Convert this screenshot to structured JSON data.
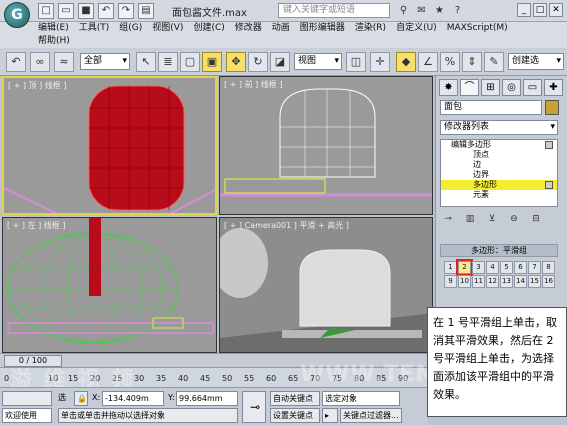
{
  "app": {
    "title": "面包酱文件.max",
    "help_search_placeholder": "键入关键字或短语"
  },
  "menu": [
    "编辑(E)",
    "工具(T)",
    "组(G)",
    "视图(V)",
    "创建(C)",
    "修改器",
    "动画",
    "图形编辑器",
    "渲染(R)",
    "自定义(U)",
    "MAXScript(M)",
    "帮助(H)"
  ],
  "toolbar": {
    "selection_filter": "全部",
    "coord_system": "视图",
    "named_selection": "创建选"
  },
  "viewports": {
    "top": "[ + ] 顶 ] 线框 ]",
    "front": "[ + ] 前 ] 线框 ]",
    "left": "[ + ] 左 ] 线框 ]",
    "camera": "[ + ] Camera001 ] 平滑 + 高光 ]"
  },
  "command_panel": {
    "object_name": "面包",
    "modifier_list": "修改器列表",
    "stack": [
      {
        "label": "编辑多边形",
        "level": "top"
      },
      {
        "label": "顶点",
        "level": "sub"
      },
      {
        "label": "边",
        "level": "sub"
      },
      {
        "label": "边界",
        "level": "sub"
      },
      {
        "label": "多边形",
        "level": "sub"
      },
      {
        "label": "元素",
        "level": "sub"
      }
    ],
    "rollout_title": "多边形：平滑组",
    "smoothing_groups": [
      "1",
      "2",
      "3",
      "4",
      "5",
      "6",
      "7",
      "8",
      "9",
      "10",
      "11",
      "12",
      "13",
      "14",
      "15",
      "16"
    ],
    "highlighted_group": "2"
  },
  "timeline": {
    "frame": "0 / 100",
    "ticks": [
      "0",
      "10",
      "15",
      "20",
      "25",
      "30",
      "35",
      "40",
      "45",
      "50",
      "55",
      "60",
      "65",
      "70",
      "75",
      "80",
      "85",
      "90"
    ]
  },
  "status": {
    "welcome": "欢迎使用",
    "select_label": "选",
    "x_value": "-134.409m",
    "y_value": "99.664mm",
    "auto_key": "自动关键点",
    "set_key": "设置关键点",
    "selected_object": "选定对象",
    "key_filters": "关键点过滤器...",
    "prompt": "单击或单击并拖动以选择对象"
  },
  "watermark": {
    "left": "溢 维 视 频",
    "right": "WWW.TEMI.NET"
  },
  "callout_text": "在 1 号平滑组上单击，取消其平滑效果，然后在 2 号平滑组上单击，为选择面添加该平滑组中的平滑效果。"
}
